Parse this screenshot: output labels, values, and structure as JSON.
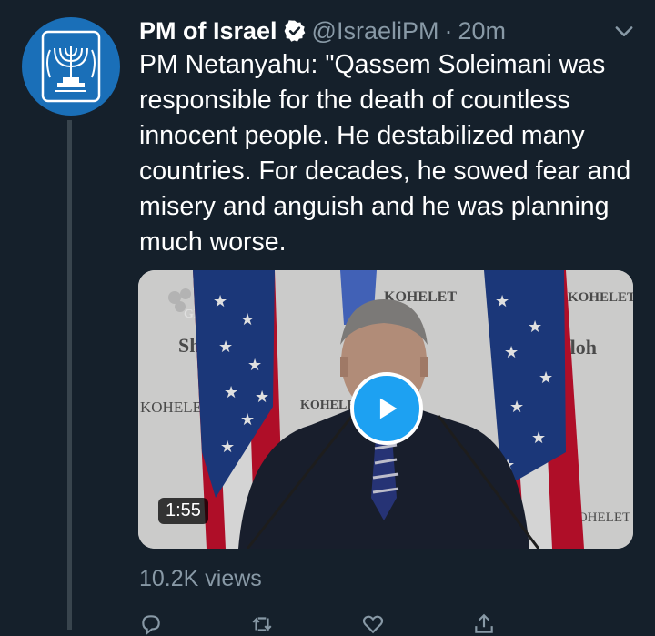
{
  "account": {
    "name": "PM of Israel",
    "handle": "@IsraeliPM",
    "separator": "·",
    "time": "20m",
    "avatar_icon": "menorah-emblem-icon",
    "avatar_color": "#1a6fb8",
    "verified_color": "#ffffff"
  },
  "tweet": {
    "text": "PM Netanyahu: \"Qassem Soleimani was responsible for the death of countless innocent people. He destabilized many countries. For decades, he sowed fear and misery and anguish and he was planning much worse."
  },
  "media": {
    "duration": "1:55",
    "play_icon": "play-icon",
    "accent": "#1da1f2",
    "banner_texts": [
      "KOHELET",
      "KOHELET",
      "KOHELET",
      "KOHELET",
      "KOHELET",
      "Shiloh",
      "Shiloh",
      "GPO"
    ]
  },
  "stats": {
    "views": "10.2K views"
  },
  "actions": [
    {
      "icon": "reply-icon"
    },
    {
      "icon": "retweet-icon"
    },
    {
      "icon": "like-icon"
    },
    {
      "icon": "share-icon"
    }
  ],
  "theme": {
    "background": "#15202b",
    "secondary_text": "#8899a6",
    "line": "#38444d"
  }
}
